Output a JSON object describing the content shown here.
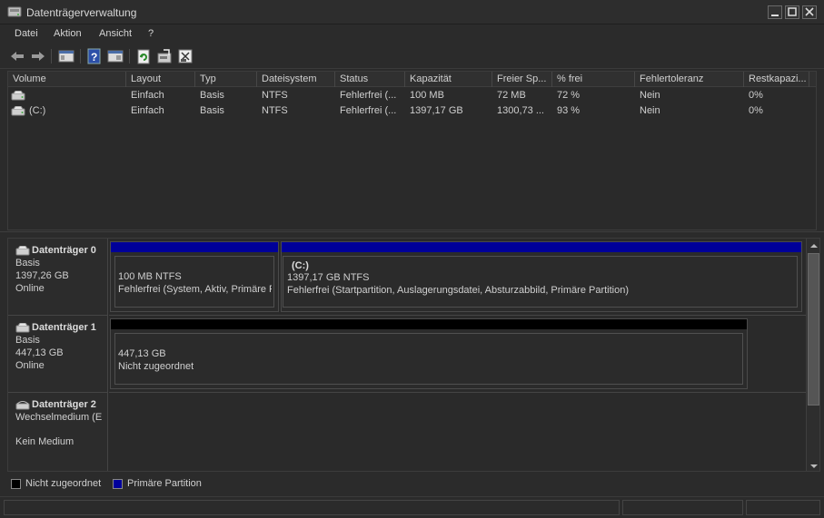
{
  "window": {
    "title": "Datenträgerverwaltung"
  },
  "menu": {
    "items": [
      "Datei",
      "Aktion",
      "Ansicht",
      "?"
    ]
  },
  "volumes": {
    "columns": [
      "Volume",
      "Layout",
      "Typ",
      "Dateisystem",
      "Status",
      "Kapazität",
      "Freier Sp...",
      "% frei",
      "Fehlertoleranz",
      "Restkapazi..."
    ],
    "rows": [
      [
        "",
        "Einfach",
        "Basis",
        "NTFS",
        "Fehlerfrei (...",
        "100 MB",
        "72 MB",
        "72 %",
        "Nein",
        "0%"
      ],
      [
        "(C:)",
        "Einfach",
        "Basis",
        "NTFS",
        "Fehlerfrei (...",
        "1397,17 GB",
        "1300,73 ...",
        "93 %",
        "Nein",
        "0%"
      ]
    ]
  },
  "disks": [
    {
      "name": "Datenträger 0",
      "type": "Basis",
      "size": "1397,26 GB",
      "state": "Online",
      "partitions": [
        {
          "title": "",
          "size": "100 MB NTFS",
          "status": "Fehlerfrei (System, Aktiv, Primäre Partition)"
        },
        {
          "title": "(C:)",
          "size": "1397,17 GB NTFS",
          "status": "Fehlerfrei (Startpartition, Auslagerungsdatei, Absturzabbild, Primäre Partition)"
        }
      ]
    },
    {
      "name": "Datenträger 1",
      "type": "Basis",
      "size": "447,13 GB",
      "state": "Online",
      "partitions": [
        {
          "title": "",
          "size": "447,13 GB",
          "status": "Nicht zugeordnet"
        }
      ]
    },
    {
      "name": "Datenträger 2",
      "type": "Wechselmedium (E",
      "size": "",
      "state": "Kein Medium",
      "partitions": []
    }
  ],
  "legend": [
    {
      "label": "Nicht zugeordnet",
      "color": "#000000"
    },
    {
      "label": "Primäre Partition",
      "color": "#00009c"
    }
  ],
  "colors": {
    "primary_partition": "#000099",
    "unallocated": "#000000"
  }
}
